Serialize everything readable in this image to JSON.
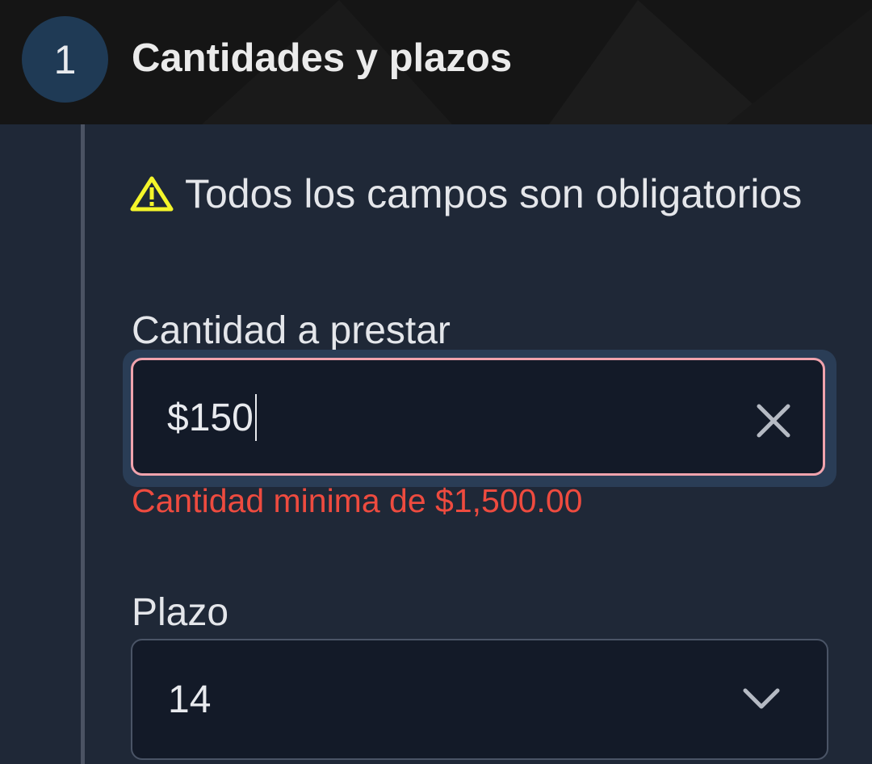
{
  "step": {
    "number": "1",
    "title": "Cantidades y plazos"
  },
  "notice": {
    "text": "Todos los campos son obligatorios",
    "icon": "warning-icon",
    "icon_color": "#f4f52a"
  },
  "amount": {
    "label": "Cantidad a prestar",
    "value": "$150",
    "clear_icon": "close-icon",
    "error": "Cantidad minima de $1,500.00",
    "error_color": "#ee4b3f",
    "border_color": "#f0a3ad"
  },
  "term": {
    "label": "Plazo",
    "value": "14",
    "dropdown_icon": "chevron-down-icon"
  }
}
